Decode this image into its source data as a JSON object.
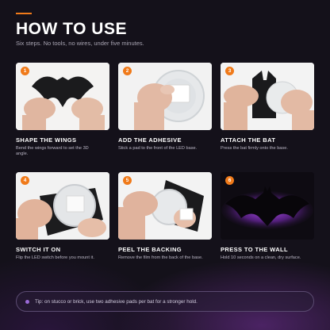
{
  "header": {
    "title": "HOW TO USE",
    "subtitle": "Six steps. No tools, no wires, under five minutes."
  },
  "steps": [
    {
      "number": "1",
      "title": "SHAPE THE WINGS",
      "desc": "Bend the wings forward to set the 3D angle.",
      "photo_icon": "bat-wings-hands-icon"
    },
    {
      "number": "2",
      "title": "ADD THE ADHESIVE",
      "desc": "Stick a pad to the front of the LED base.",
      "photo_icon": "adhesive-pad-icon"
    },
    {
      "number": "3",
      "title": "ATTACH THE BAT",
      "desc": "Press the bat firmly onto the base.",
      "photo_icon": "attach-bat-icon"
    },
    {
      "number": "4",
      "title": "SWITCH IT ON",
      "desc": "Flip the LED switch before you mount it.",
      "photo_icon": "led-switch-icon"
    },
    {
      "number": "5",
      "title": "PEEL THE BACKING",
      "desc": "Remove the film from the back of the base.",
      "photo_icon": "peel-backing-icon"
    },
    {
      "number": "6",
      "title": "PRESS TO THE WALL",
      "desc": "Hold 10 seconds on a clean, dry surface.",
      "photo_icon": "glowing-bat-icon"
    }
  ],
  "tip": {
    "text": "Tip: on stucco or brick, use two adhesive pads per bat for a stronger hold."
  },
  "colors": {
    "accent": "#f07a1a",
    "background": "#14111a",
    "glow": "#b04cff"
  }
}
